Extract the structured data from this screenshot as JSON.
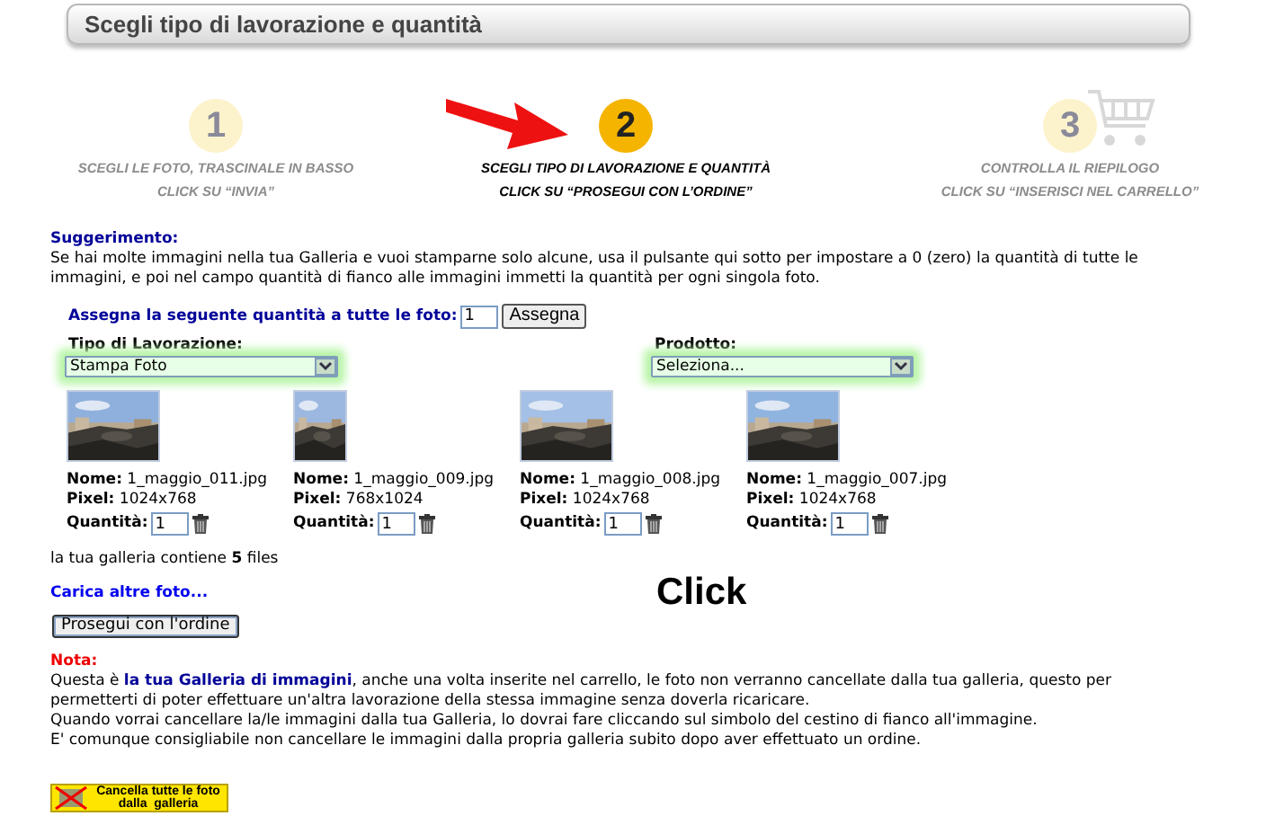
{
  "header": {
    "title": "Scegli tipo di lavorazione e quantità"
  },
  "steps": [
    {
      "number": "1",
      "line_1": "SCEGLI LE FOTO, TRASCINALE IN BASSO",
      "line_2": "CLICK SU “INVIA”",
      "selected": false
    },
    {
      "number": "2",
      "line_1": "SCEGLI TIPO DI LAVORAZIONE E QUANTITÀ",
      "line_2": "CLICK SU “PROSEGUI CON L’ORDINE”",
      "selected": true
    },
    {
      "number": "3",
      "line_1": "CONTROLLA IL RIEPILOGO",
      "line_2": "CLICK SU “INSERISCI NEL CARRELLO”",
      "selected": false
    }
  ],
  "hint": {
    "title": "Suggerimento:",
    "text": "Se hai molte immagini nella tua Galleria e vuoi stamparne solo alcune, usa il pulsante qui sotto per impostare a 0 (zero) la quantità di tutte le immagini, e poi nel campo quantità di fianco alle immagini immetti la quantità per ogni singola foto."
  },
  "assign": {
    "label": "Assegna la seguente quantità a tutte le foto:",
    "value": "1",
    "button": "Assegna"
  },
  "selects": [
    {
      "label": "Tipo di Lavorazione:",
      "value": "Stampa Foto"
    },
    {
      "label": "Prodotto:",
      "value": "Seleziona..."
    }
  ],
  "photos": [
    {
      "kind": "picture",
      "name": "**Nome:** 1_maggio_011.jpg",
      "pixel": "**Pixel:** 1024x768",
      "qty_label": "Quantità:",
      "qty": "1"
    },
    {
      "kind": "picture",
      "name": "**Nome:** 1_maggio_009.jpg",
      "pixel": "**Pixel:** 768x1024",
      "qty_label": "Quantità:",
      "qty": "1"
    },
    {
      "kind": "picture",
      "name": "**Nome:** 1_maggio_008.jpg",
      "pixel": "**Pixel:** 1024x768",
      "qty_label": "Quantità:",
      "qty": "1"
    },
    {
      "kind": "picture",
      "name": "**Nome:** 1_maggio_007.jpg",
      "pixel": "**Pixel:** 1024x768",
      "qty_label": "Quantità:",
      "qty": "1"
    }
  ],
  "gallery_count": "la tua galleria contiene **5** files",
  "upload_link": "Carica altre foto...",
  "annotation": "Click",
  "proceed_button": "Prosegui con l'ordine",
  "note": {
    "title": "Nota:",
    "before": "Questa è ",
    "link": "la tua Galleria di immagini",
    "after": ", anche una volta inserite nel carrello, le foto non verranno cancellate dalla tua galleria, questo per permetterti di poter effettuare un'altra lavorazione della stessa immagine senza doverla ricaricare.",
    "lines": [
      "Quando vorrai cancellare la/le immagini dalla tua Galleria, lo dovrai fare cliccando sul simbolo del cestino di fianco all'immagine.",
      "E' comunque consigliabile non cancellare le immagini dalla propria galleria subito dopo aver effettuato un ordine."
    ]
  },
  "delete_button": {
    "line_1": "Cancella tutte le foto",
    "line_2": "dalla  galleria"
  }
}
